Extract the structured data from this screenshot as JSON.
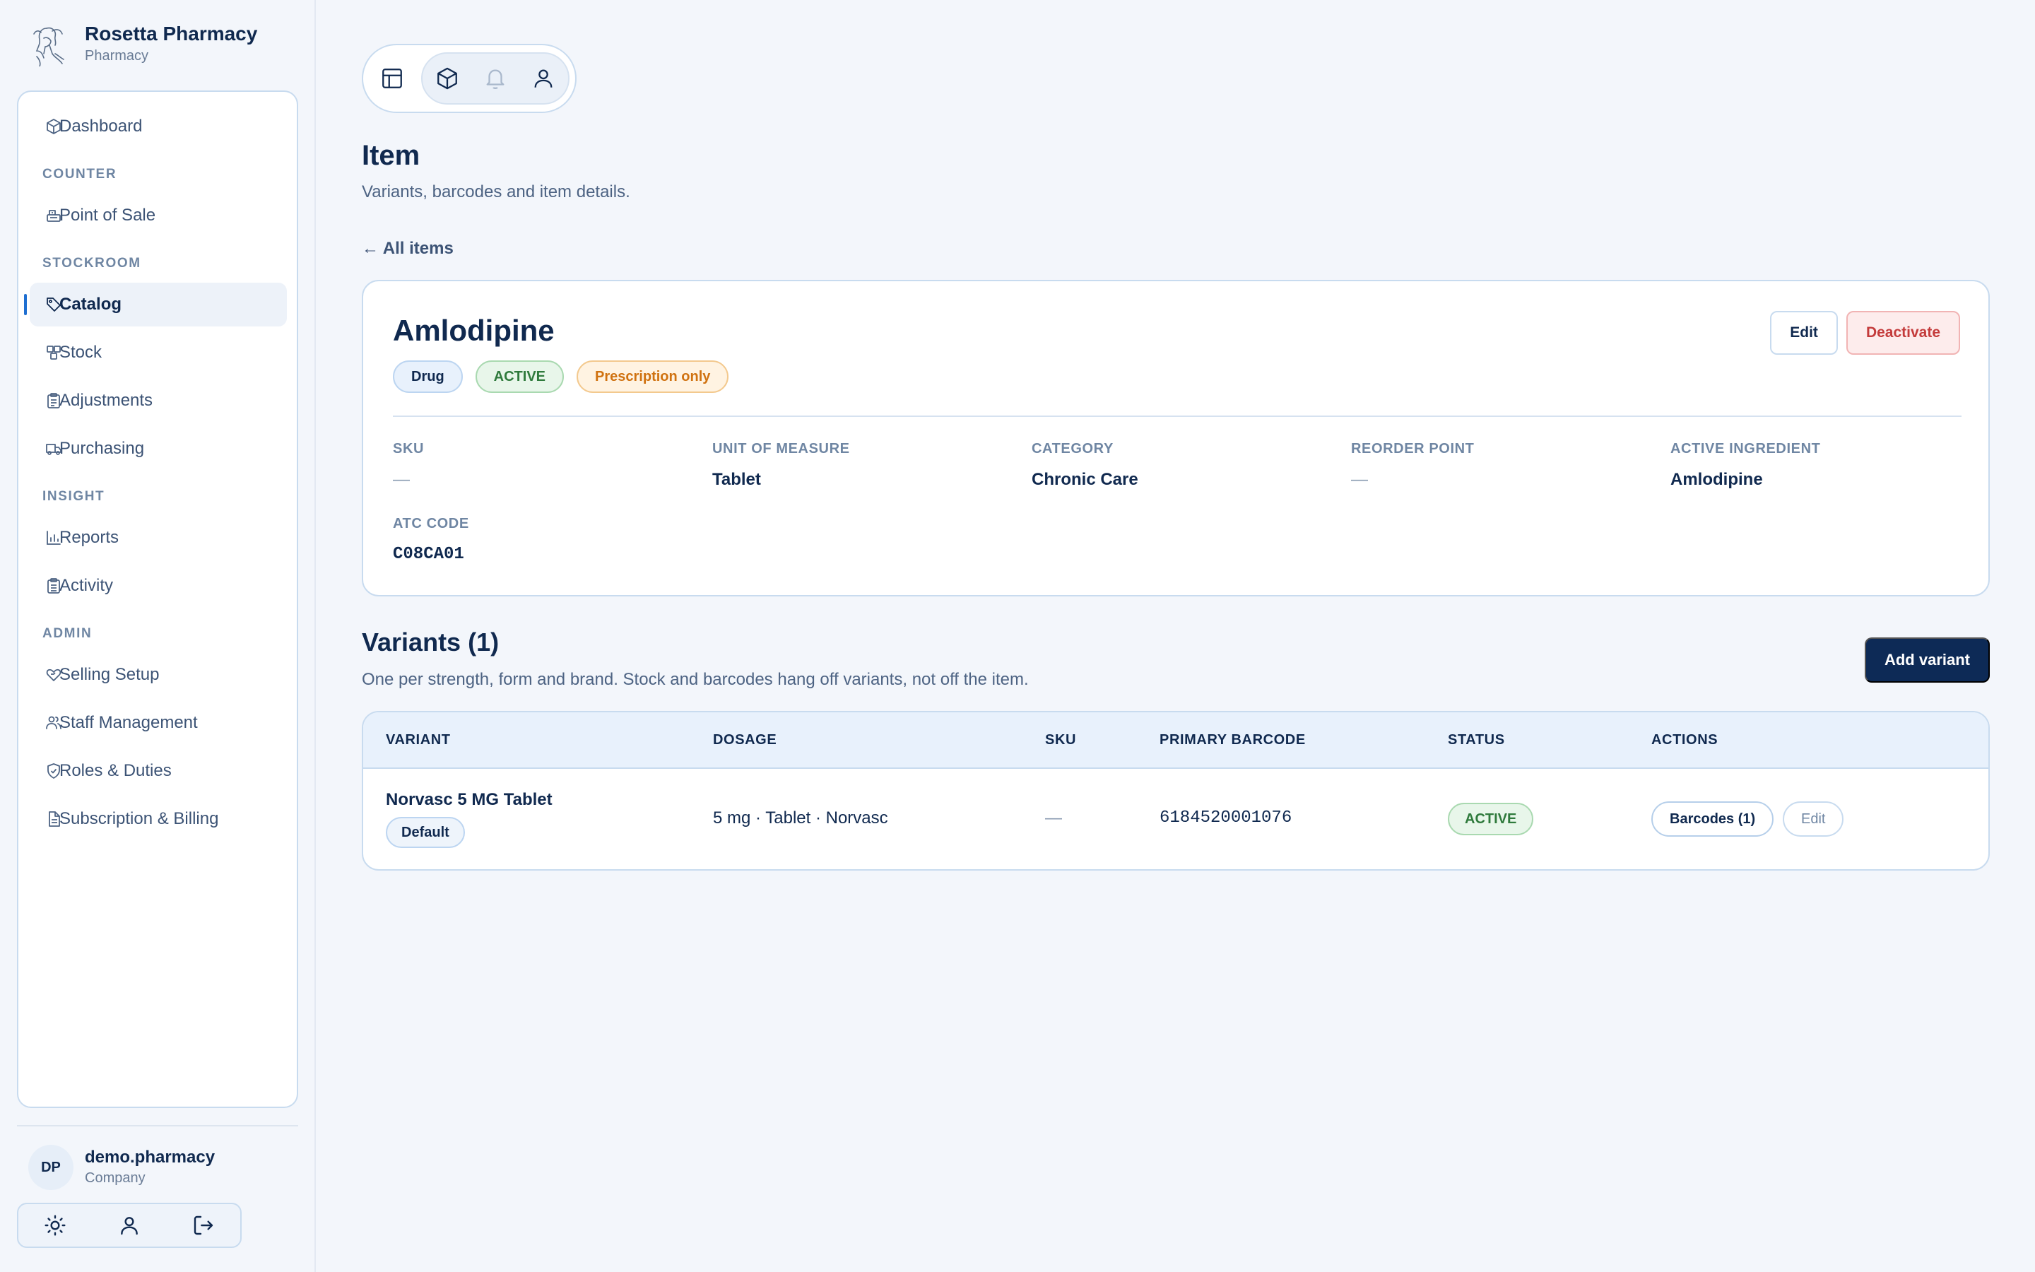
{
  "brand": {
    "name": "Rosetta Pharmacy",
    "subtitle": "Pharmacy",
    "logo_icon": "portrait-logo"
  },
  "sidebar": {
    "dashboard": {
      "label": "Dashboard",
      "icon": "cube-icon"
    },
    "sections": {
      "counter": "COUNTER",
      "stockroom": "STOCKROOM",
      "insight": "INSIGHT",
      "admin": "ADMIN"
    },
    "items": {
      "pos": {
        "label": "Point of Sale",
        "icon": "register-icon"
      },
      "catalog": {
        "label": "Catalog",
        "icon": "tag-icon",
        "active": true
      },
      "stock": {
        "label": "Stock",
        "icon": "boxes-icon"
      },
      "adjustments": {
        "label": "Adjustments",
        "icon": "clipboard-icon"
      },
      "purchasing": {
        "label": "Purchasing",
        "icon": "truck-icon"
      },
      "reports": {
        "label": "Reports",
        "icon": "bar-chart-icon"
      },
      "activity": {
        "label": "Activity",
        "icon": "clipboard-list-icon"
      },
      "selling": {
        "label": "Selling Setup",
        "icon": "tag-heart-icon"
      },
      "staff": {
        "label": "Staff Management",
        "icon": "users-icon"
      },
      "roles": {
        "label": "Roles & Duties",
        "icon": "shield-check-icon"
      },
      "billing": {
        "label": "Subscription & Billing",
        "icon": "document-icon"
      }
    },
    "user": {
      "initials": "DP",
      "name": "demo.pharmacy",
      "role": "Company"
    },
    "user_actions": [
      "sun-icon",
      "user-icon",
      "logout-icon"
    ]
  },
  "toolbar": {
    "icons": [
      "layout-icon",
      "cube-icon",
      "bell-icon",
      "user-icon"
    ]
  },
  "page": {
    "title": "Item",
    "subtitle": "Variants, barcodes and item details.",
    "back_link": "← All items"
  },
  "item": {
    "name": "Amlodipine",
    "badges": {
      "type": "Drug",
      "status": "ACTIVE",
      "rx": "Prescription only"
    },
    "edit_label": "Edit",
    "deactivate_label": "Deactivate",
    "fields": {
      "sku": {
        "label": "SKU",
        "value": "—"
      },
      "uom": {
        "label": "UNIT OF MEASURE",
        "value": "Tablet"
      },
      "category": {
        "label": "CATEGORY",
        "value": "Chronic Care"
      },
      "reorder": {
        "label": "REORDER POINT",
        "value": "—"
      },
      "ingredient": {
        "label": "ACTIVE INGREDIENT",
        "value": "Amlodipine"
      },
      "atc": {
        "label": "ATC CODE",
        "value": "C08CA01"
      }
    }
  },
  "variants": {
    "title": "Variants (1)",
    "subtitle": "One per strength, form and brand. Stock and barcodes hang off variants, not off the item.",
    "add_label": "Add variant",
    "columns": {
      "variant": "VARIANT",
      "dosage": "DOSAGE",
      "sku": "SKU",
      "barcode": "PRIMARY BARCODE",
      "status": "STATUS",
      "actions": "ACTIONS"
    },
    "rows": [
      {
        "name": "Norvasc 5 MG Tablet",
        "default_badge": "Default",
        "dosage": "5 mg · Tablet · Norvasc",
        "sku": "—",
        "barcode": "6184520001076",
        "status": "ACTIVE",
        "barcodes_label": "Barcodes (1)",
        "edit_label": "Edit"
      }
    ]
  },
  "colors": {
    "accent": "#1f6fd1",
    "navy": "#0d2a56",
    "success": "#2f7a3c",
    "warning": "#d07210",
    "danger": "#c43b3b"
  }
}
